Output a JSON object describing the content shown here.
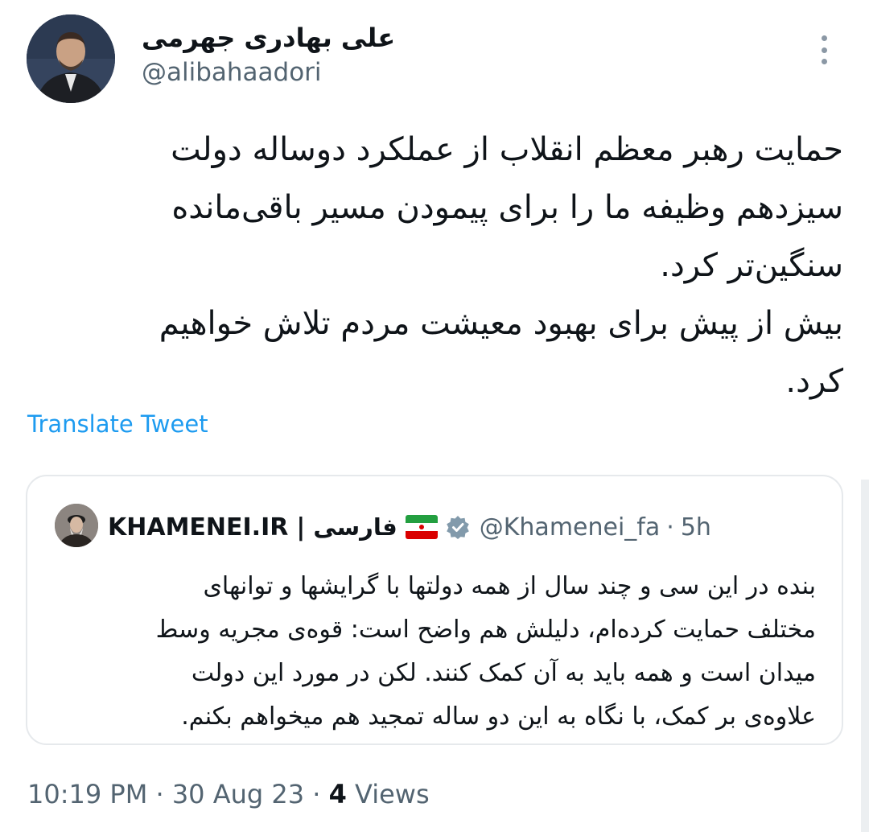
{
  "tweet": {
    "author_name": "علی بهادری جهرمی",
    "author_handle": "@alibahaadori",
    "body_lines": [
      "حمایت رهبر معظم انقلاب از عملکرد دوساله دولت",
      "سیزدهم وظیفه ما را برای پیمودن مسیر باقی‌مانده",
      "سنگین‌تر کرد.",
      "بیش از پیش برای بهبود معیشت مردم تلاش خواهیم",
      "کرد."
    ],
    "translate_label": "Translate Tweet",
    "icons": {
      "more": "more-vertical-icon"
    }
  },
  "quoted": {
    "name": "KHAMENEI.IR",
    "separator": "|",
    "name_farsi": "فارسی",
    "flag": "iran-flag-icon",
    "verified": "verified-badge-icon",
    "handle": "@Khamenei_fa",
    "dot": "·",
    "time": "5h",
    "text_lines": [
      "بنده در این سی و چند سال از همه دولتها با گرایشها و توانهای",
      "مختلف حمایت کرده‌ام، دلیلش هم واضح است: قوه‌ی مجریه وسط",
      "میدان است و همه باید به آن کمک کنند.  لکن در مورد این دولت",
      "علاوه‌ی بر کمک، با نگاه به این دو ساله تمجید هم میخواهم بکنم."
    ]
  },
  "meta": {
    "time": "10:19 PM",
    "sep1": " · ",
    "date": "30 Aug 23",
    "sep2": " · ",
    "views_count": "4",
    "views_label": " Views"
  },
  "colors": {
    "link": "#1d9bf0",
    "secondary": "#536471",
    "text": "#0f1419",
    "border": "#e6e9ec"
  }
}
